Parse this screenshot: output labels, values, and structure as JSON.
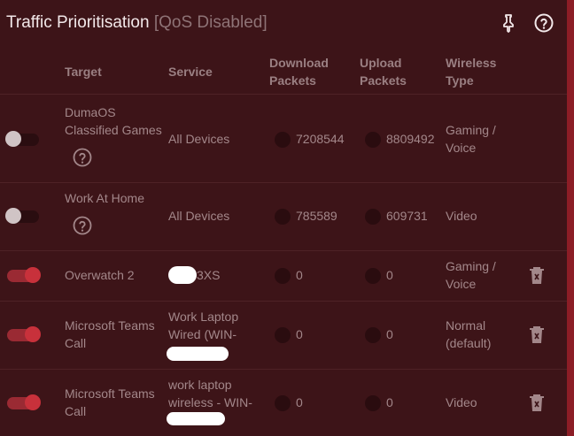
{
  "header": {
    "title": "Traffic Prioritisation",
    "status": "[QoS Disabled]",
    "pin_icon": "pin-icon",
    "help_icon": "help-circle-icon"
  },
  "columns": {
    "target": "Target",
    "service": "Service",
    "download_line1": "Download",
    "download_line2": "Packets",
    "upload_line1": "Upload",
    "upload_line2": "Packets",
    "wireless_line1": "Wireless",
    "wireless_line2": "Type"
  },
  "rows": [
    {
      "enabled": false,
      "target_line1": "DumaOS",
      "target_line2": "Classified Games",
      "service_line1": "All Devices",
      "service_line2": "",
      "download": "7208544",
      "upload": "8809492",
      "type_line1": "Gaming /",
      "type_line2": "Voice"
    },
    {
      "enabled": false,
      "target_line1": "Work At Home",
      "target_line2": "",
      "service_line1": "All Devices",
      "service_line2": "",
      "download": "785589",
      "upload": "609731",
      "type_line1": "Video",
      "type_line2": ""
    },
    {
      "enabled": true,
      "target_line1": "Overwatch 2",
      "target_line2": "",
      "service_line1": "3XS",
      "service_line2": "",
      "download": "0",
      "upload": "0",
      "type_line1": "Gaming /",
      "type_line2": "Voice"
    },
    {
      "enabled": true,
      "target_line1": "Microsoft Teams",
      "target_line2": "Call",
      "service_line1": "Work Laptop",
      "service_line2": "Wired (WIN-",
      "download": "0",
      "upload": "0",
      "type_line1": "Normal",
      "type_line2": "(default)"
    },
    {
      "enabled": true,
      "target_line1": "Microsoft Teams",
      "target_line2": "Call",
      "service_line1": "work laptop",
      "service_line2": "wireless - WIN-",
      "download": "0",
      "upload": "0",
      "type_line1": "Video",
      "type_line2": ""
    }
  ],
  "colors": {
    "background": "#3d1418",
    "accent": "#c8313b",
    "edge": "#8c1d26"
  }
}
